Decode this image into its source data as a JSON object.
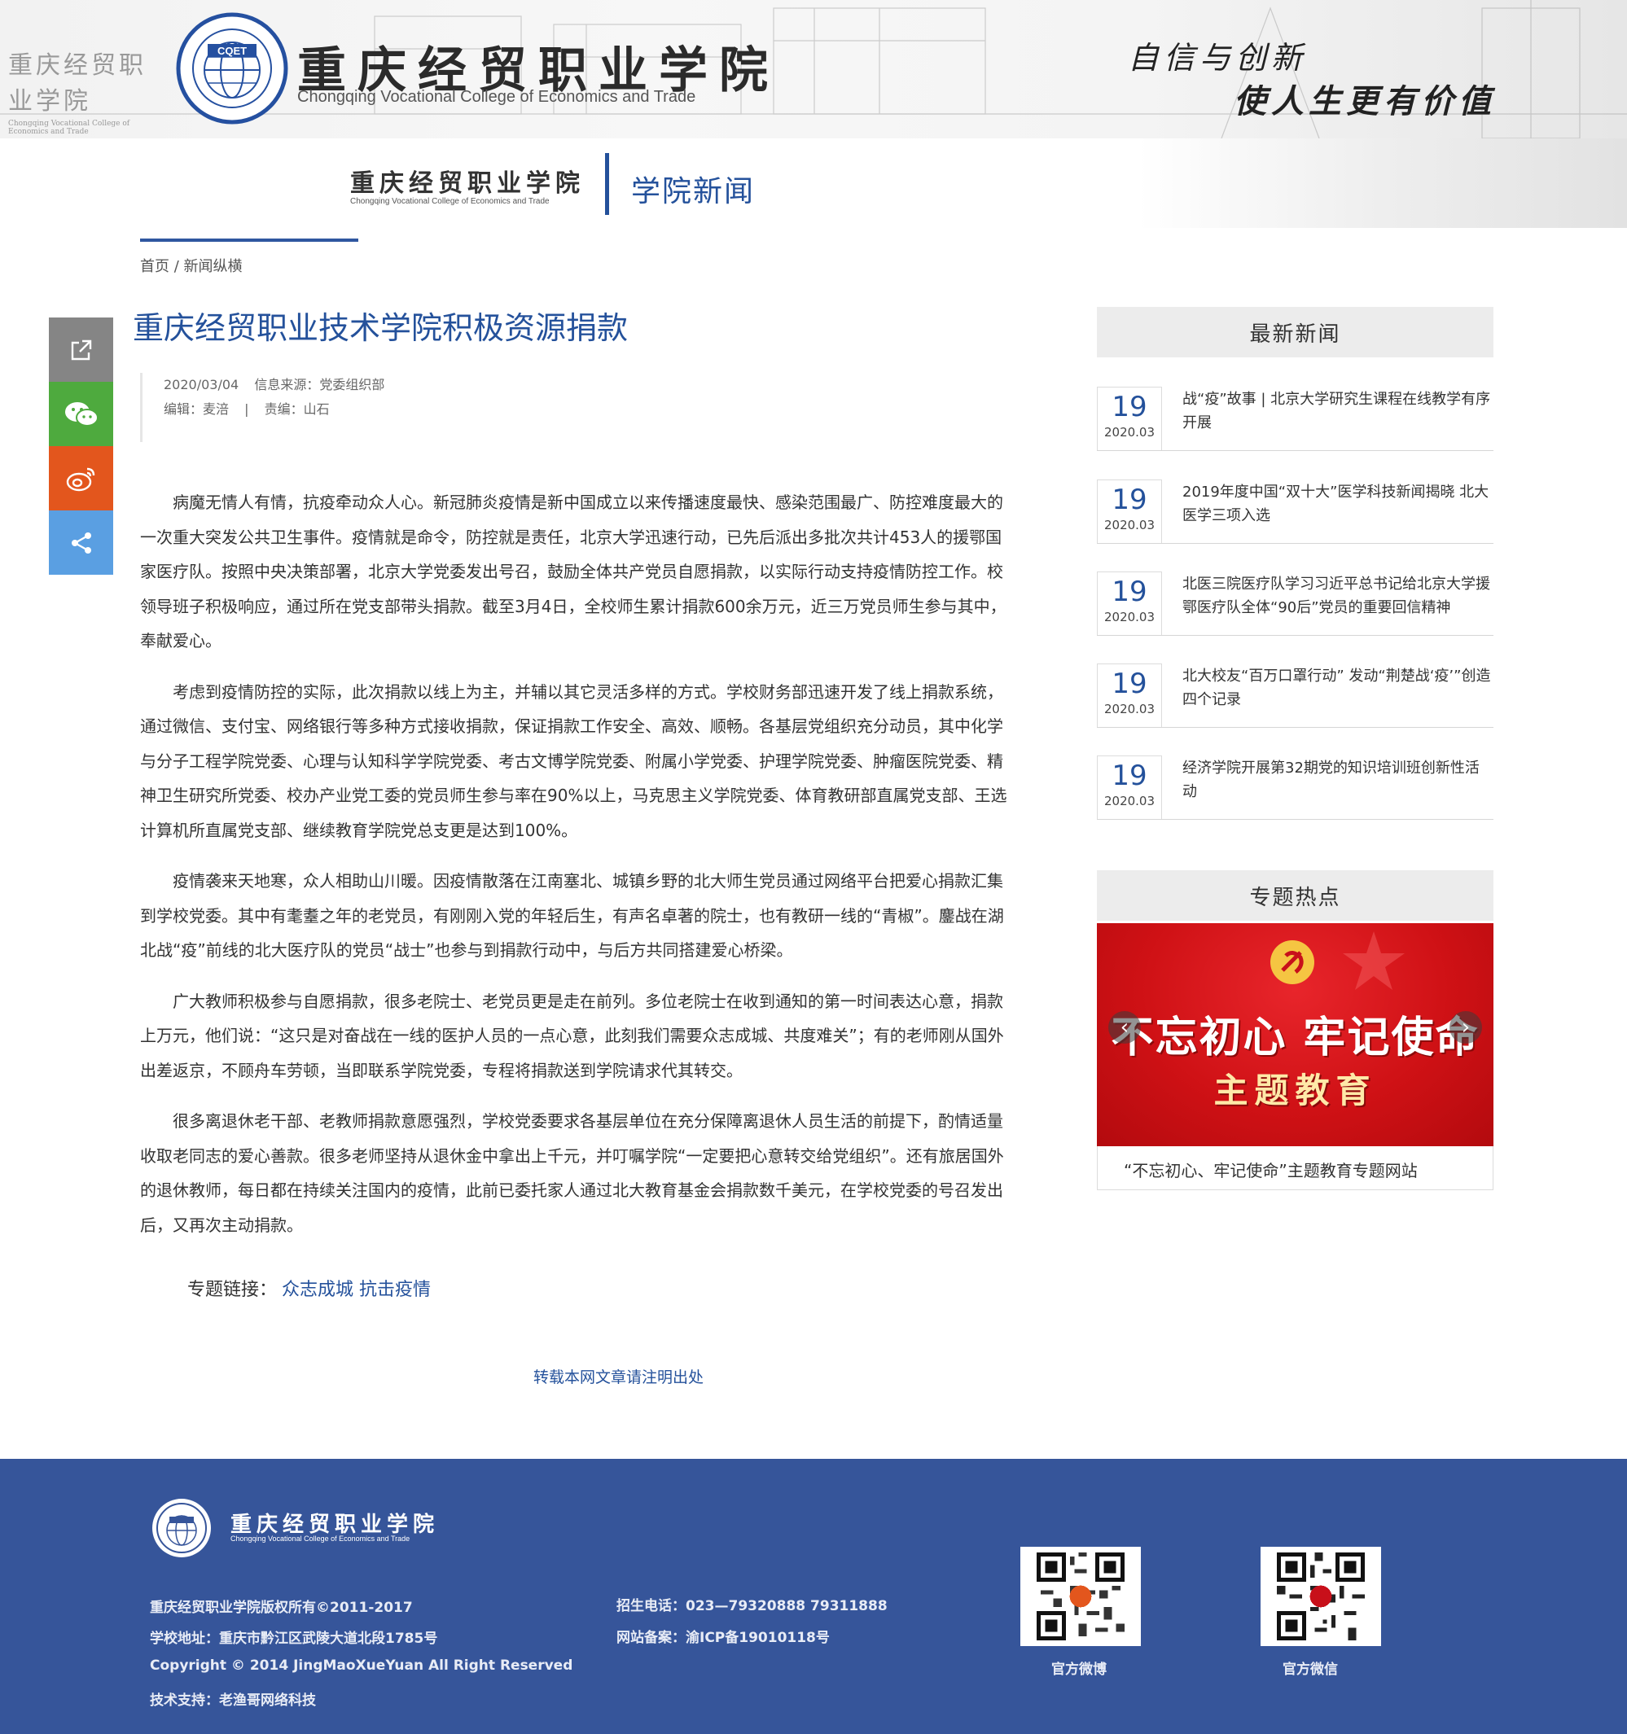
{
  "header": {
    "college_name": "重庆经贸职业学院",
    "college_name_en": "Chongqing Vocational College of Economics and Trade",
    "logo_text": "CQET",
    "slogan_line1": "自信与创新",
    "slogan_line2": "使人生更有价值"
  },
  "subheader": {
    "college_name": "重庆经贸职业学院",
    "college_name_en": "Chongqing Vocational College of Economics and Trade",
    "section_title": "学院新闻"
  },
  "breadcrumb": {
    "home": "首页",
    "separator": " / ",
    "current": "新闻纵横"
  },
  "share_bar": {
    "icons": [
      "share-icon",
      "wechat-icon",
      "weibo-icon",
      "more-share-icon"
    ],
    "colors": [
      "#858585",
      "#4eaa3e",
      "#e3561d",
      "#5a9fe2"
    ]
  },
  "article": {
    "title": "重庆经贸职业技术学院积极资源捐款",
    "date": "2020/03/04",
    "source_label": "信息来源：",
    "source": "党委组织部",
    "editor_label": "编辑：",
    "editor": "麦涪",
    "meta_sep": "|",
    "chief_editor_label": "责编：",
    "chief_editor": "山石",
    "paragraphs": [
      "病魔无情人有情，抗疫牵动众人心。新冠肺炎疫情是新中国成立以来传播速度最快、感染范围最广、防控难度最大的一次重大突发公共卫生事件。疫情就是命令，防控就是责任，北京大学迅速行动，已先后派出多批次共计453人的援鄂国家医疗队。按照中央决策部署，北京大学党委发出号召，鼓励全体共产党员自愿捐款，以实际行动支持疫情防控工作。校领导班子积极响应，通过所在党支部带头捐款。截至3月4日，全校师生累计捐款600余万元，近三万党员师生参与其中，奉献爱心。",
      "考虑到疫情防控的实际，此次捐款以线上为主，并辅以其它灵活多样的方式。学校财务部迅速开发了线上捐款系统，通过微信、支付宝、网络银行等多种方式接收捐款，保证捐款工作安全、高效、顺畅。各基层党组织充分动员，其中化学与分子工程学院党委、心理与认知科学学院党委、考古文博学院党委、附属小学党委、护理学院党委、肿瘤医院党委、精神卫生研究所党委、校办产业党工委的党员师生参与率在90%以上，马克思主义学院党委、体育教研部直属党支部、王选计算机所直属党支部、继续教育学院党总支更是达到100%。",
      "疫情袭来天地寒，众人相助山川暖。因疫情散落在江南塞北、城镇乡野的北大师生党员通过网络平台把爱心捐款汇集到学校党委。其中有耄耋之年的老党员，有刚刚入党的年轻后生，有声名卓著的院士，也有教研一线的“青椒”。鏖战在湖北战“疫”前线的北大医疗队的党员“战士”也参与到捐款行动中，与后方共同搭建爱心桥梁。",
      "广大教师积极参与自愿捐款，很多老院士、老党员更是走在前列。多位老院士在收到通知的第一时间表达心意，捐款上万元，他们说：“这只是对奋战在一线的医护人员的一点心意，此刻我们需要众志成城、共度难关”；有的老师刚从国外出差返京，不顾舟车劳顿，当即联系学院党委，专程将捐款送到学院请求代其转交。",
      "很多离退休老干部、老教师捐款意愿强烈，学校党委要求各基层单位在充分保障离退休人员生活的前提下，酌情适量收取老同志的爱心善款。很多老师坚持从退休金中拿出上千元，并叮嘱学院“一定要把心意转交给党组织”。还有旅居国外的退休教师，每日都在持续关注国内的疫情，此前已委托家人通过北大教育基金会捐款数千美元，在学校党委的号召发出后，又再次主动捐款。"
    ],
    "topic_links_label": "专题链接：",
    "topic_links": "众志成城 抗击疫情",
    "repost_notice": "转载本网文章请注明出处"
  },
  "sidebar": {
    "latest_title": "最新新闻",
    "latest": [
      {
        "day": "19",
        "month": "2020.03",
        "title": "战“疫”故事 | 北京大学研究生课程在线教学有序开展"
      },
      {
        "day": "19",
        "month": "2020.03",
        "title": "2019年度中国“双十大”医学科技新闻揭晓 北大医学三项入选"
      },
      {
        "day": "19",
        "month": "2020.03",
        "title": "北医三院医疗队学习习近平总书记给北京大学援鄂医疗队全体“90后”党员的重要回信精神"
      },
      {
        "day": "19",
        "month": "2020.03",
        "title": "北大校友“百万口罩行动” 发动“荆楚战‘疫’”创造四个记录"
      },
      {
        "day": "19",
        "month": "2020.03",
        "title": "经济学院开展第32期党的知识培训班创新性活动"
      }
    ],
    "hot_title": "专题热点",
    "hot_banner_line1": "不忘初心 牢记使命",
    "hot_banner_line2": "主题教育",
    "hot_prev": "‹",
    "hot_next": "›",
    "hot_caption": "“不忘初心、牢记使命”主题教育专题网站",
    "hot_banner_color": "#cf1115"
  },
  "footer": {
    "college_name": "重庆经贸职业学院",
    "college_name_en": "Chongqing Vocational College of Economics and Trade",
    "copyright": "重庆经贸职业学院版权所有©2011-2017",
    "address": "学校地址：重庆市黔江区武陵大道北段1785号",
    "copyright_en": "Copyright © 2014 JingMaoXueYuan All Right Reserved",
    "tech_support": "技术支持：老渔哥网络科技",
    "phone": "招生电话：023—79320888 79311888",
    "icp": "网站备案：渝ICP备19010118号",
    "qr_weibo_label": "官方微博",
    "qr_wechat_label": "官方微信",
    "bg_color": "#36559a"
  }
}
